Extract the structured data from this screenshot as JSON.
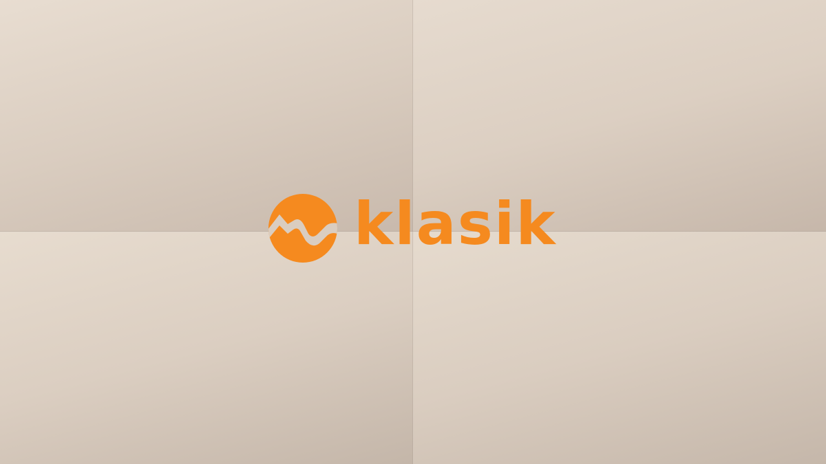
{
  "brand": {
    "name": "klasik",
    "accent_color": "#f58a1f",
    "icon": "klasik-logo-icon"
  },
  "background": {
    "colors": [
      "#e8ddd1",
      "#c6b7aa"
    ]
  }
}
